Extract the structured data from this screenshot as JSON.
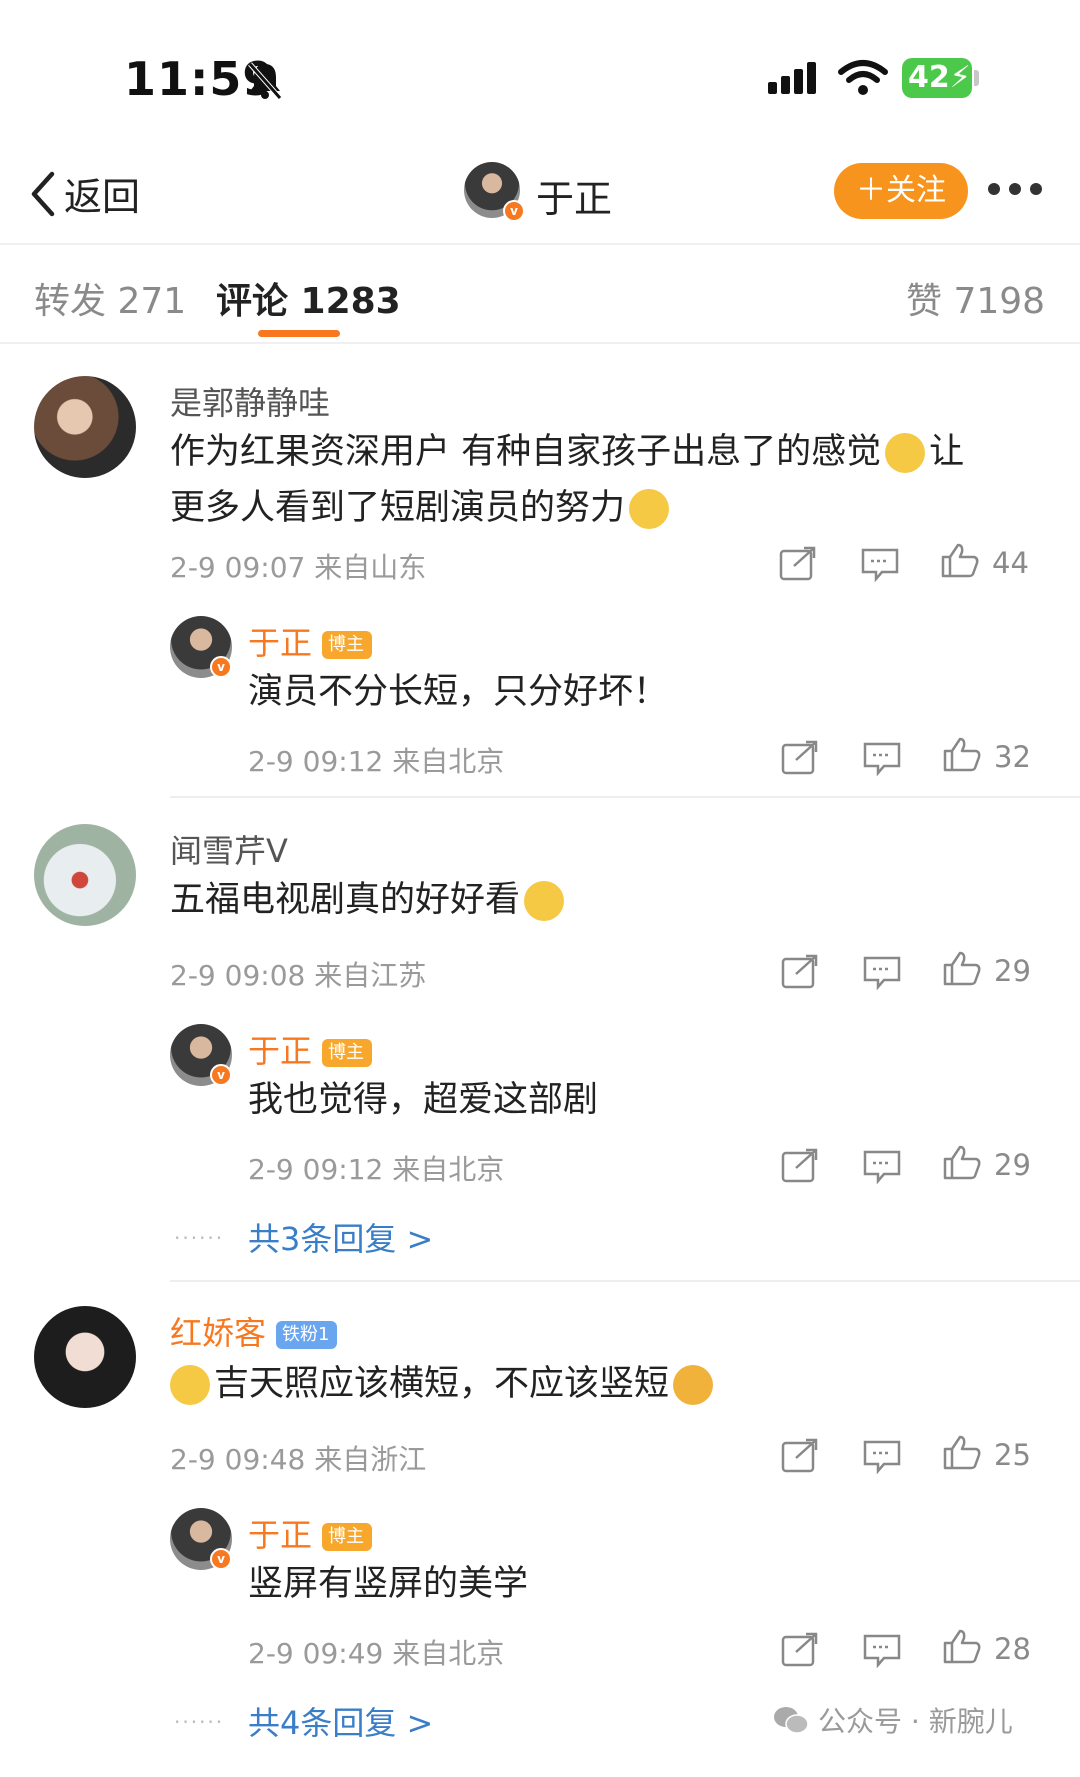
{
  "status_bar": {
    "time": "11:59",
    "battery": "42"
  },
  "nav": {
    "back_label": "返回",
    "title": "于正",
    "follow_label": "＋关注"
  },
  "tabs": [
    {
      "label": "转发 271"
    },
    {
      "label": "评论 1283",
      "active": true
    },
    {
      "label": "赞 7198"
    }
  ],
  "comments": [
    {
      "user": "是郭静静哇",
      "text_line1": "作为红果资深用户  有种自家孩子出息了的感觉",
      "text_line1_tail": "让",
      "text_line2": "更多人看到了短剧演员的努力",
      "meta": "2-9 09:07 来自山东",
      "likes": "44",
      "reply": {
        "user": "于正",
        "badge": "博主",
        "text": "演员不分长短，只分好坏！",
        "meta": "2-9 09:12 来自北京",
        "likes": "32"
      }
    },
    {
      "user": "闻雪芹V",
      "text_line1": "五福电视剧真的好好看",
      "meta": "2-9 09:08 来自江苏",
      "likes": "29",
      "reply": {
        "user": "于正",
        "badge": "博主",
        "text": "我也觉得，超爱这部剧",
        "meta": "2-9 09:12 来自北京",
        "likes": "29"
      },
      "more_replies": "共3条回复 >"
    },
    {
      "user": "红娇客",
      "badge": "铁粉1",
      "text_line1": "吉天照应该横短，不应该竖短",
      "meta": "2-9 09:48 来自浙江",
      "likes": "25",
      "reply": {
        "user": "于正",
        "badge": "博主",
        "text": "竖屏有竖屏的美学",
        "meta": "2-9 09:49 来自北京",
        "likes": "28"
      },
      "more_replies": "共4条回复 >"
    }
  ],
  "watermark": "公众号 · 新腕儿",
  "colors": {
    "accent": "#f7781f",
    "link": "#3a7ec8",
    "battery": "#4cc94b"
  }
}
